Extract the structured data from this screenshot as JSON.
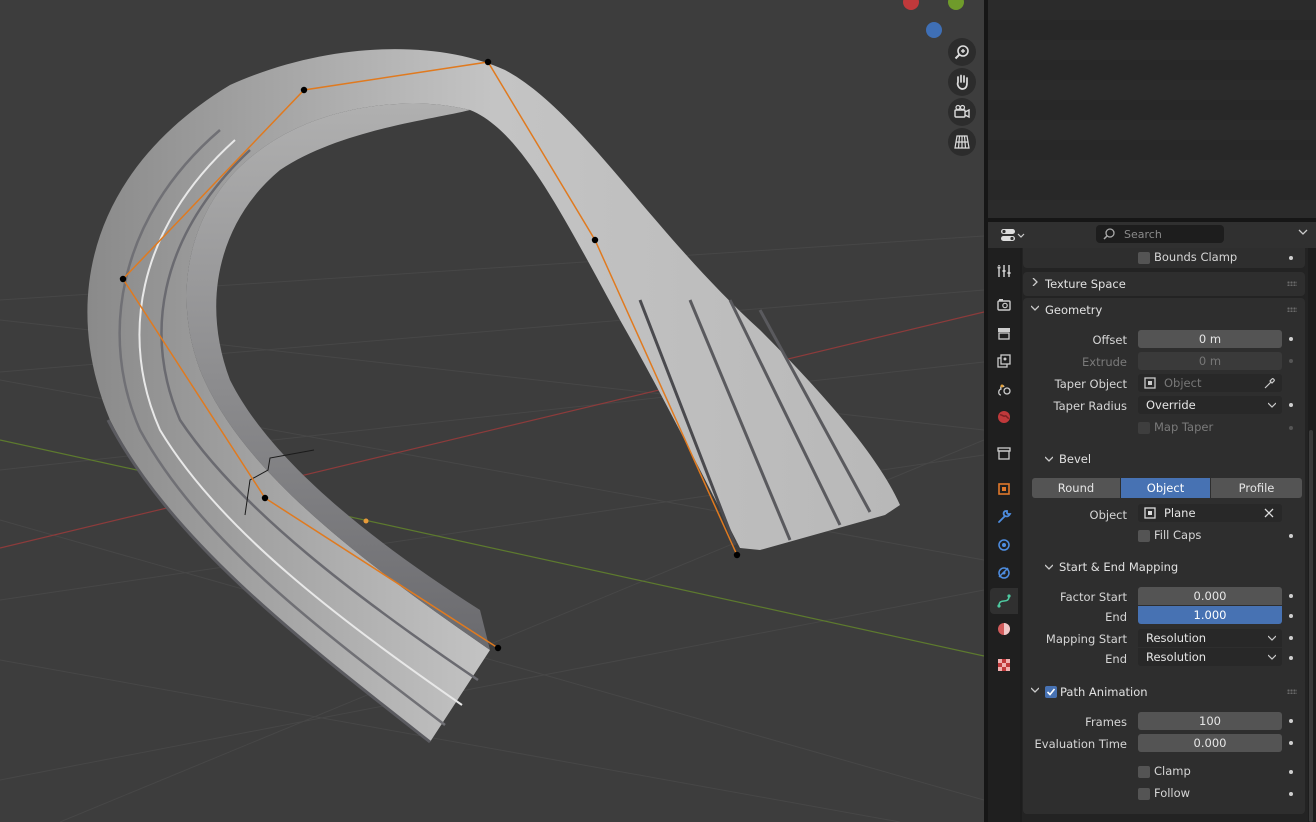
{
  "header": {
    "search_placeholder": "Search"
  },
  "panels": {
    "bounds_clamp_label": "Bounds Clamp",
    "texture_space_label": "Texture Space",
    "geometry": {
      "label": "Geometry",
      "offset_label": "Offset",
      "offset_value": "0 m",
      "extrude_label": "Extrude",
      "extrude_value": "0 m",
      "taper_object_label": "Taper Object",
      "taper_object_placeholder": "Object",
      "taper_radius_label": "Taper Radius",
      "taper_radius_value": "Override",
      "map_taper_label": "Map Taper"
    },
    "bevel": {
      "label": "Bevel",
      "modes": [
        "Round",
        "Object",
        "Profile"
      ],
      "active_mode": "Object",
      "object_label": "Object",
      "object_value": "Plane",
      "fill_caps_label": "Fill Caps"
    },
    "mapping": {
      "label": "Start & End Mapping",
      "factor_start_label": "Factor Start",
      "factor_start_value": "0.000",
      "factor_end_label": "End",
      "factor_end_value": "1.000",
      "mapping_start_label": "Mapping Start",
      "mapping_start_value": "Resolution",
      "mapping_end_label": "End",
      "mapping_end_value": "Resolution"
    },
    "path_animation": {
      "label": "Path Animation",
      "enabled": true,
      "frames_label": "Frames",
      "frames_value": "100",
      "eval_time_label": "Evaluation Time",
      "eval_time_value": "0.000",
      "clamp_label": "Clamp",
      "follow_label": "Follow"
    }
  },
  "tabs": [
    "tool",
    "render",
    "output",
    "view-layer",
    "scene",
    "world",
    "collection",
    "object",
    "modifiers",
    "particles",
    "physics",
    "constraints",
    "data",
    "material",
    "texture"
  ],
  "active_tab": "data",
  "colors": {
    "accent": "#4772b3",
    "curve_edit": "#e07a1f",
    "axis_x": "#9a3a3a",
    "axis_y": "#5d7a2e"
  }
}
